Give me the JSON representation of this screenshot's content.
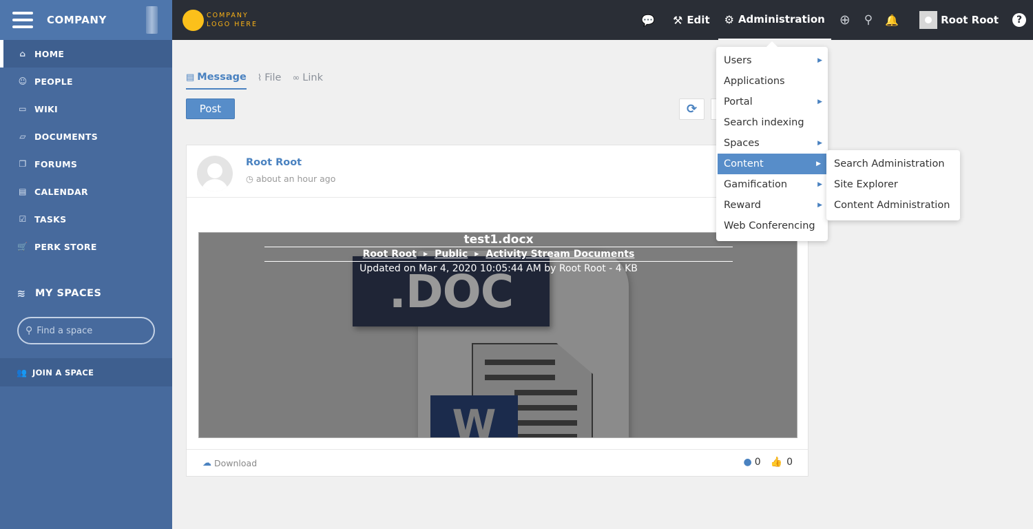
{
  "sidebar": {
    "company": "COMPANY",
    "nav": [
      {
        "label": "HOME",
        "icon": "home-icon",
        "active": true
      },
      {
        "label": "PEOPLE",
        "icon": "people-icon"
      },
      {
        "label": "WIKI",
        "icon": "wiki-icon"
      },
      {
        "label": "DOCUMENTS",
        "icon": "folder-icon"
      },
      {
        "label": "FORUMS",
        "icon": "forums-icon"
      },
      {
        "label": "CALENDAR",
        "icon": "calendar-icon"
      },
      {
        "label": "TASKS",
        "icon": "check-square-icon"
      },
      {
        "label": "PERK STORE",
        "icon": "cart-icon"
      }
    ],
    "my_spaces": "MY SPACES",
    "find_space_placeholder": "Find a space",
    "join_space": "JOIN A SPACE"
  },
  "topbar": {
    "logo_line1": "COMPANY",
    "logo_line2": "LOGO HERE",
    "edit_label": "Edit",
    "admin_label": "Administration",
    "user_name": "Root Root",
    "help_label": "?"
  },
  "composer": {
    "tabs": [
      "Message",
      "File",
      "Link"
    ],
    "post_label": "Post"
  },
  "activity": {
    "author": "Root Root",
    "time": "about an hour ago",
    "file": {
      "name": "test1.docx",
      "breadcrumb": [
        "Root Root",
        "Public",
        "Activity Stream Documents"
      ],
      "meta": "Updated on Mar 4, 2020 10:05:44 AM by Root Root - 4 KB",
      "preview_label": ".DOC",
      "preview_letter": "W"
    },
    "download_label": "Download",
    "comments": "0",
    "likes": "0"
  },
  "admin_menu": {
    "items": [
      {
        "label": "Users",
        "has_sub": true
      },
      {
        "label": "Applications",
        "has_sub": false
      },
      {
        "label": "Portal",
        "has_sub": true
      },
      {
        "label": "Search indexing",
        "has_sub": false
      },
      {
        "label": "Spaces",
        "has_sub": true
      },
      {
        "label": "Content",
        "has_sub": true,
        "active": true
      },
      {
        "label": "Gamification",
        "has_sub": true
      },
      {
        "label": "Reward",
        "has_sub": true
      },
      {
        "label": "Web Conferencing",
        "has_sub": false
      }
    ],
    "content_submenu": [
      "Search Administration",
      "Site Explorer",
      "Content Administration"
    ]
  },
  "colors": {
    "sidebar": "#476a9d",
    "topbar": "#2a2e36",
    "accent": "#578dc9",
    "logo": "#fbc01b"
  }
}
